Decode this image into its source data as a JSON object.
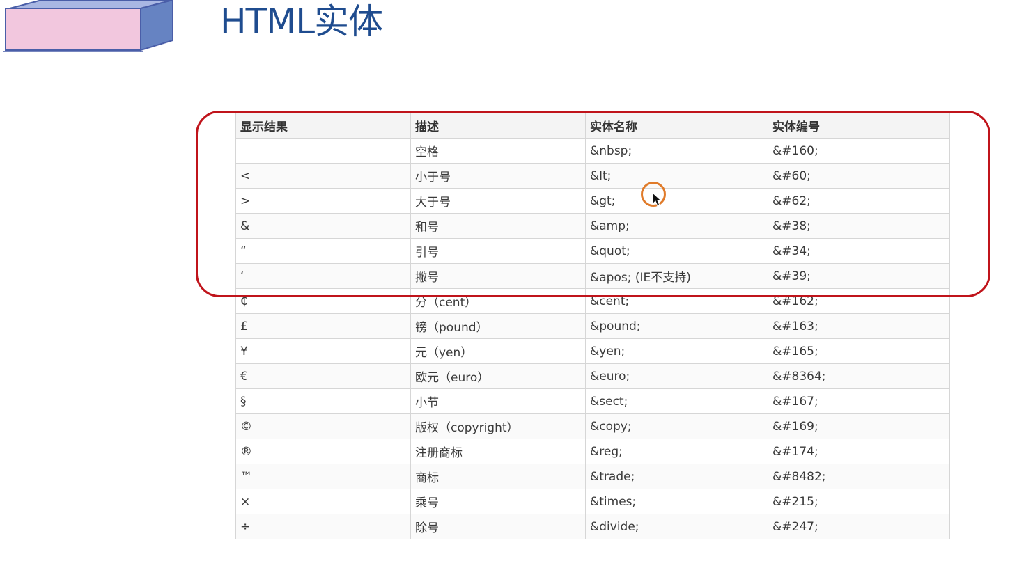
{
  "page": {
    "title": "HTML实体"
  },
  "table": {
    "headers": [
      "显示结果",
      "描述",
      "实体名称",
      "实体编号"
    ],
    "rows": [
      [
        "",
        "空格",
        "&nbsp;",
        "&#160;"
      ],
      [
        "<",
        "小于号",
        "&lt;",
        "&#60;"
      ],
      [
        ">",
        "大于号",
        "&gt;",
        "&#62;"
      ],
      [
        "&",
        "和号",
        "&amp;",
        "&#38;"
      ],
      [
        "“",
        "引号",
        "&quot;",
        "&#34;"
      ],
      [
        "‘",
        "撇号",
        "&apos; (IE不支持)",
        "&#39;"
      ],
      [
        "₵",
        "分（cent）",
        "&cent;",
        "&#162;"
      ],
      [
        "£",
        "镑（pound）",
        "&pound;",
        "&#163;"
      ],
      [
        "¥",
        "元（yen）",
        "&yen;",
        "&#165;"
      ],
      [
        "€",
        "欧元（euro）",
        "&euro;",
        "&#8364;"
      ],
      [
        "§",
        "小节",
        "&sect;",
        "&#167;"
      ],
      [
        "©",
        "版权（copyright）",
        "&copy;",
        "&#169;"
      ],
      [
        "®",
        "注册商标",
        "&reg;",
        "&#174;"
      ],
      [
        "™",
        "商标",
        "&trade;",
        "&#8482;"
      ],
      [
        "×",
        "乘号",
        "&times;",
        "&#215;"
      ],
      [
        "÷",
        "除号",
        "&divide;",
        "&#247;"
      ]
    ]
  },
  "annotation": {
    "highlight_color": "#c0141b",
    "cursor_ring_color": "#e07b2a",
    "highlighted_rows": 6
  },
  "colors": {
    "title": "#1f4c8f",
    "logo_front": "#f2c7de",
    "logo_side": "#6683c2",
    "logo_top": "#a9b7e3"
  },
  "icons": [
    "box-logo-icon",
    "mouse-pointer-icon"
  ]
}
